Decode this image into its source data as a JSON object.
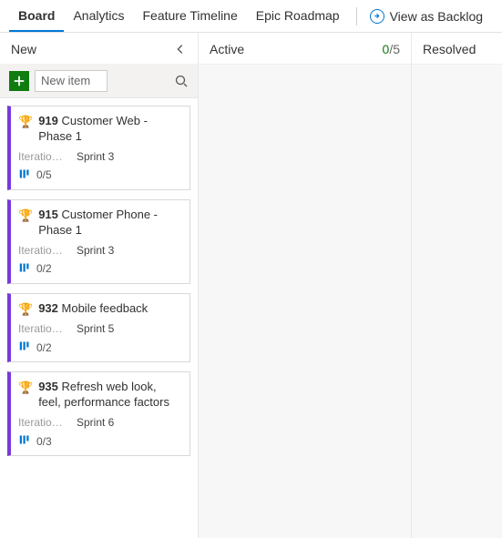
{
  "tabs": {
    "items": [
      {
        "label": "Board",
        "active": true
      },
      {
        "label": "Analytics",
        "active": false
      },
      {
        "label": "Feature Timeline",
        "active": false
      },
      {
        "label": "Epic Roadmap",
        "active": false
      }
    ],
    "view_backlog": "View as Backlog"
  },
  "columns": {
    "new": {
      "title": "New",
      "new_item_placeholder": "New item",
      "cards": [
        {
          "id": "919",
          "title": "Customer Web - Phase 1",
          "field_label": "Iteration …",
          "field_value": "Sprint 3",
          "progress": "0/5"
        },
        {
          "id": "915",
          "title": "Customer Phone - Phase 1",
          "field_label": "Iteration …",
          "field_value": "Sprint 3",
          "progress": "0/2"
        },
        {
          "id": "932",
          "title": "Mobile feedback",
          "field_label": "Iteration …",
          "field_value": "Sprint 5",
          "progress": "0/2"
        },
        {
          "id": "935",
          "title": "Refresh web look, feel, performance factors",
          "field_label": "Iteration …",
          "field_value": "Sprint 6",
          "progress": "0/3"
        }
      ]
    },
    "active": {
      "title": "Active",
      "wip_current": "0",
      "wip_limit": "/5"
    },
    "resolved": {
      "title": "Resolved"
    }
  }
}
